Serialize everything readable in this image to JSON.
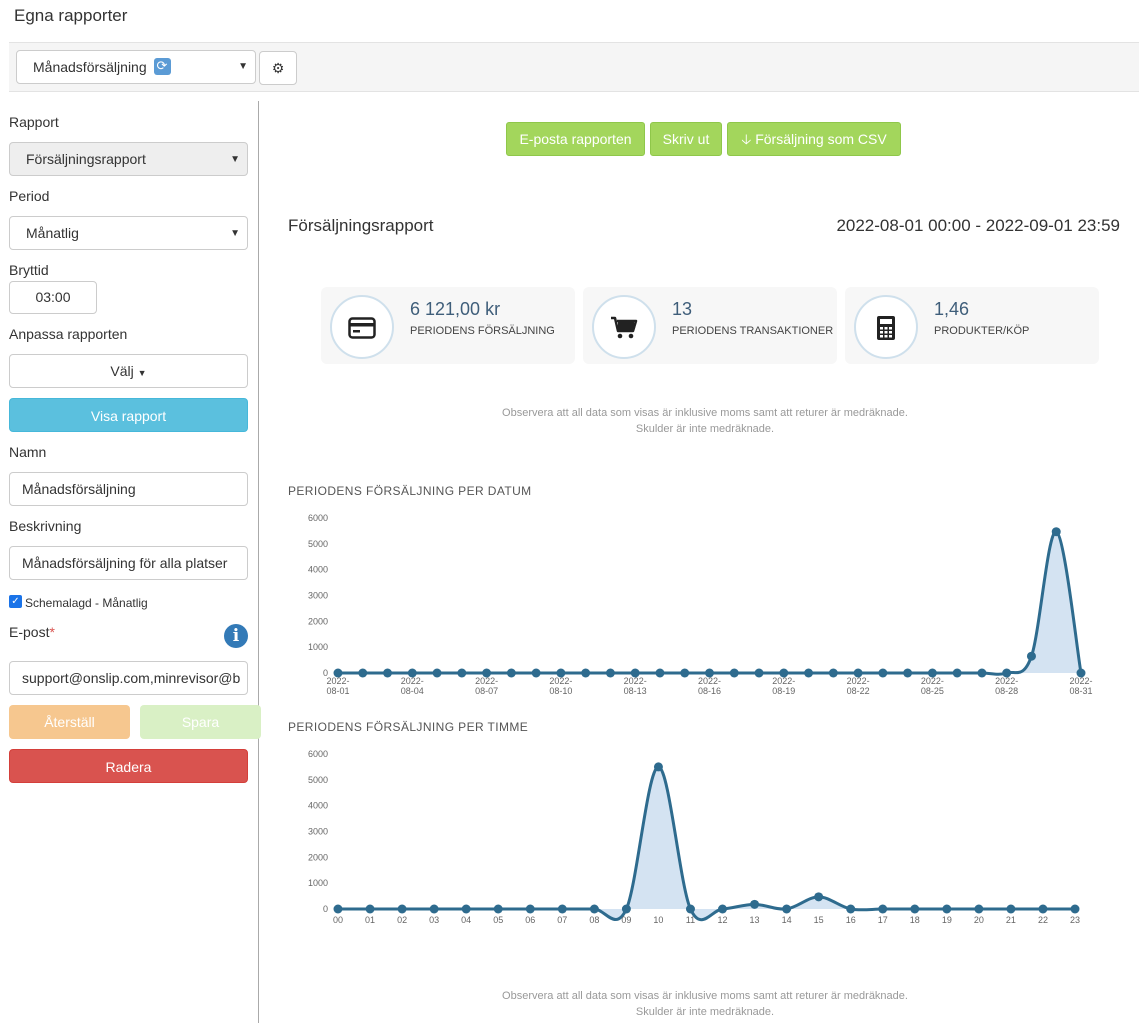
{
  "page_title": "Egna rapporter",
  "topbar": {
    "report_select_value": "Månadsförsäljning",
    "refresh_icon": "refresh-icon",
    "settings_icon": "gear-icon"
  },
  "sidebar": {
    "rapport_label": "Rapport",
    "rapport_value": "Försäljningsrapport",
    "period_label": "Period",
    "period_value": "Månatlig",
    "brytid_label": "Bryttid",
    "brytid_value": "03:00",
    "anpassa_label": "Anpassa rapporten",
    "valj_label": "Välj",
    "visa_label": "Visa rapport",
    "namn_label": "Namn",
    "namn_value": "Månadsförsäljning",
    "beskrivning_label": "Beskrivning",
    "beskrivning_value": "Månadsförsäljning för alla platser",
    "schemalagd_label": "Schemalagd - Månatlig",
    "schemalagd_checked": true,
    "epost_label": "E-post",
    "epost_required": "*",
    "epost_value": "support@onslip.com,minrevisor@b",
    "aterstall_label": "Återställ",
    "spara_label": "Spara",
    "radera_label": "Radera"
  },
  "actions": {
    "email_label": "E-posta rapporten",
    "print_label": "Skriv ut",
    "csv_label": "Försäljning som CSV"
  },
  "report": {
    "heading": "Försäljningsrapport",
    "range": "2022-08-01 00:00 - 2022-09-01 23:59"
  },
  "kpis": [
    {
      "value": "6 121,00 kr",
      "caption": "PERIODENS FÖRSÄLJNING",
      "icon": "credit-card-icon"
    },
    {
      "value": "13",
      "caption": "PERIODENS TRANSAKTIONER",
      "icon": "shopping-cart-icon"
    },
    {
      "value": "1,46",
      "caption": "PRODUKTER/KÖP",
      "icon": "calculator-icon"
    }
  ],
  "notes": {
    "line1": "Observera att all data som visas är inklusive moms samt att returer är medräknade.",
    "line2": "Skulder är inte medräknade."
  },
  "colors": {
    "line": "#2e6b8e",
    "fill": "#d4e3f2",
    "green": "#a3d65c",
    "blue": "#5bc0de",
    "red": "#d9534f",
    "orange": "#f6c78f"
  },
  "chart_data": [
    {
      "type": "area",
      "title": "PERIODENS FÖRSÄLJNING PER DATUM",
      "ylim": [
        0,
        6000
      ],
      "yticks": [
        0,
        1000,
        2000,
        3000,
        4000,
        5000,
        6000
      ],
      "x": [
        "08-01",
        "08-02",
        "08-03",
        "08-04",
        "08-05",
        "08-06",
        "08-07",
        "08-08",
        "08-09",
        "08-10",
        "08-11",
        "08-12",
        "08-13",
        "08-14",
        "08-15",
        "08-16",
        "08-17",
        "08-18",
        "08-19",
        "08-20",
        "08-21",
        "08-22",
        "08-23",
        "08-24",
        "08-25",
        "08-26",
        "08-27",
        "08-28",
        "08-29",
        "08-30",
        "08-31"
      ],
      "xtick_labels": [
        [
          "2022-",
          "08-01"
        ],
        [
          "2022-",
          "08-04"
        ],
        [
          "2022-",
          "08-07"
        ],
        [
          "2022-",
          "08-10"
        ],
        [
          "2022-",
          "08-13"
        ],
        [
          "2022-",
          "08-16"
        ],
        [
          "2022-",
          "08-19"
        ],
        [
          "2022-",
          "08-22"
        ],
        [
          "2022-",
          "08-25"
        ],
        [
          "2022-",
          "08-28"
        ],
        [
          "2022-",
          "08-31"
        ]
      ],
      "xtick_every": 3,
      "values": [
        0,
        0,
        0,
        0,
        0,
        0,
        0,
        0,
        0,
        0,
        0,
        0,
        0,
        0,
        0,
        0,
        0,
        0,
        0,
        0,
        0,
        0,
        0,
        0,
        0,
        0,
        0,
        0,
        650,
        5470,
        0
      ]
    },
    {
      "type": "area",
      "title": "PERIODENS FÖRSÄLJNING PER TIMME",
      "ylim": [
        0,
        6000
      ],
      "yticks": [
        0,
        1000,
        2000,
        3000,
        4000,
        5000,
        6000
      ],
      "x": [
        "00",
        "01",
        "02",
        "03",
        "04",
        "05",
        "06",
        "07",
        "08",
        "09",
        "10",
        "11",
        "12",
        "13",
        "14",
        "15",
        "16",
        "17",
        "18",
        "19",
        "20",
        "21",
        "22",
        "23"
      ],
      "xtick_every": 1,
      "values": [
        0,
        0,
        0,
        0,
        0,
        0,
        0,
        0,
        0,
        0,
        5500,
        0,
        0,
        180,
        0,
        470,
        0,
        0,
        0,
        0,
        0,
        0,
        0,
        0
      ]
    }
  ]
}
